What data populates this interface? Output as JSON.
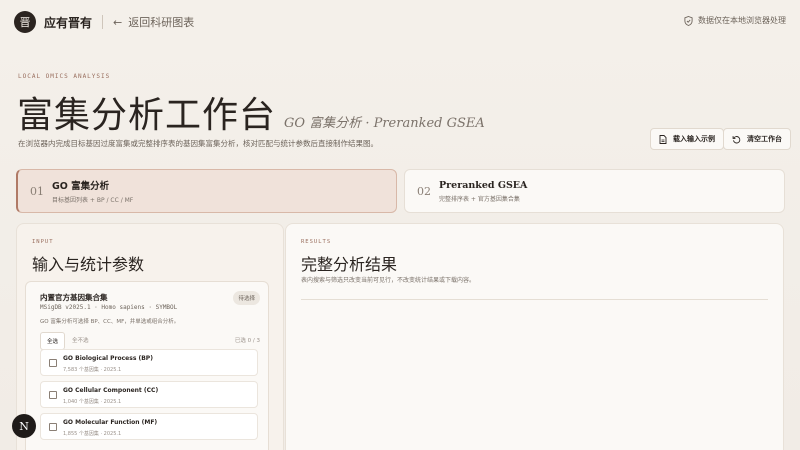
{
  "header": {
    "logo_glyph": "晋",
    "brand": "应有晋有",
    "back_label": "返回科研图表",
    "local_note": "数据仅在本地浏览器处理"
  },
  "hero": {
    "eyebrow": "LOCAL OMICS ANALYSIS",
    "title": "富集分析工作台",
    "subtitle": "GO 富集分析 · Preranked GSEA",
    "description": "在浏览器内完成目标基因过度富集或完整排序表的基因集富集分析，核对匹配与统计参数后直接制作结果图。"
  },
  "actions": {
    "load_example": "载入输入示例",
    "clear": "清空工作台"
  },
  "modes": [
    {
      "num": "01",
      "title": "GO 富集分析",
      "desc": "目标基因列表 + BP / CC / MF",
      "active": true
    },
    {
      "num": "02",
      "title": "Preranked GSEA",
      "desc": "完整排序表 + 官方基因集合集",
      "active": false
    }
  ],
  "input_panel": {
    "eyebrow": "INPUT",
    "title": "输入与统计参数",
    "gene_set": {
      "title": "内置官方基因集合集",
      "badge": "待选择",
      "meta": "MSigDB v2025.1 · Homo sapiens · SYMBOL",
      "hint": "GO 富集分析可选择 BP、CC、MF，并单选或组合分析。",
      "select_all": "全选",
      "clear_all": "全不选",
      "count": "已选 0 / 3",
      "options": [
        {
          "title": "GO Biological Process (BP)",
          "meta": "7,583 个基因集 · 2025.1"
        },
        {
          "title": "GO Cellular Component (CC)",
          "meta": "1,040 个基因集 · 2025.1"
        },
        {
          "title": "GO Molecular Function (MF)",
          "meta": "1,855 个基因集 · 2025.1"
        }
      ]
    }
  },
  "results_panel": {
    "eyebrow": "RESULTS",
    "title": "完整分析结果",
    "note": "表内搜索与筛选只改变当前可见行，不改变统计结果或下载内容。"
  },
  "fab_label": "N",
  "colors": {
    "accent": "#b07a66",
    "ink": "#2a2420",
    "bg": "#f4f0ea"
  }
}
